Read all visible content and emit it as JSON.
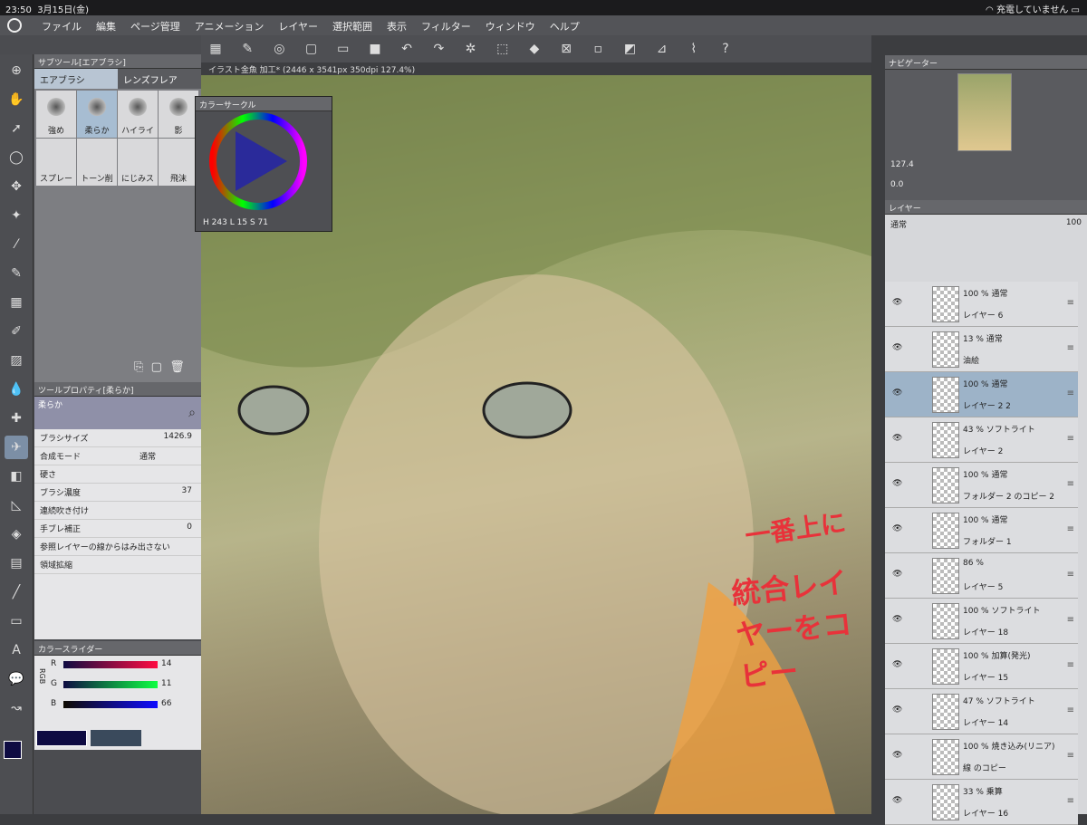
{
  "status": {
    "time": "23:50",
    "date": "3月15日(金)",
    "battery": "充電していません"
  },
  "menu": [
    "ファイル",
    "編集",
    "ページ管理",
    "アニメーション",
    "レイヤー",
    "選択範囲",
    "表示",
    "フィルター",
    "ウィンドウ",
    "ヘルプ"
  ],
  "subtool": {
    "header": "サブツール[エアブラシ]",
    "tabs": [
      "エアブラシ",
      "レンズフレア"
    ],
    "brushes": [
      "強め",
      "柔らか",
      "ハイライ",
      "影",
      "スプレー",
      "トーン削",
      "にじみス",
      "飛沫"
    ]
  },
  "toolprop": {
    "header": "ツールプロパティ[柔らか]",
    "preset": "柔らか",
    "brush_size_label": "ブラシサイズ",
    "brush_size": "1426.9",
    "blend_label": "合成モード",
    "blend": "通常",
    "hardness_label": "硬さ",
    "density_label": "ブラシ濃度",
    "density": "37",
    "continuous_label": "連続吹き付け",
    "stabilization_label": "手ブレ補正",
    "stabilization": "0",
    "ref_label": "参照レイヤーの線からはみ出さない",
    "expand_label": "領域拡縮"
  },
  "colorslider": {
    "header": "カラースライダー",
    "mode": "RGB",
    "r_label": "R",
    "r": "14",
    "g_label": "G",
    "g": "11",
    "b_label": "B",
    "b": "66"
  },
  "colorwheel": {
    "title": "カラーサークル",
    "h_label": "H",
    "h": "243",
    "l_label": "L",
    "l": "15",
    "s_label": "S",
    "s": "71"
  },
  "document": {
    "title": "イラスト金魚 加工* (2446 x 3541px 350dpi 127.4%)"
  },
  "navigator": {
    "title": "ナビゲーター",
    "zoom": "127.4",
    "angle": "0.0"
  },
  "layers": {
    "title": "レイヤー",
    "blend": "通常",
    "opacity": "100",
    "items": [
      {
        "mode": "100 % 通常",
        "name": "レイヤー 6"
      },
      {
        "mode": "13 % 通常",
        "name": "油絵"
      },
      {
        "mode": "100 % 通常",
        "name": "レイヤー 2 2"
      },
      {
        "mode": "43 % ソフトライト",
        "name": "レイヤー 2"
      },
      {
        "mode": "100 % 通常",
        "name": "フォルダー 2 のコピー 2"
      },
      {
        "mode": "100 % 通常",
        "name": "フォルダー 1"
      },
      {
        "mode": "86 %",
        "name": "レイヤー 5"
      },
      {
        "mode": "100 % ソフトライト",
        "name": "レイヤー 18"
      },
      {
        "mode": "100 % 加算(発光)",
        "name": "レイヤー 15"
      },
      {
        "mode": "47 % ソフトライト",
        "name": "レイヤー 14"
      },
      {
        "mode": "100 % 焼き込み(リニア)",
        "name": "線 のコピー"
      },
      {
        "mode": "33 % 乗算",
        "name": "レイヤー 16"
      }
    ]
  },
  "annotation": {
    "line1": "一番上に",
    "line2": "統合レイヤーをコピー"
  },
  "colors": {
    "accent": "#9db3c8",
    "main_color": "#0e0b42"
  }
}
